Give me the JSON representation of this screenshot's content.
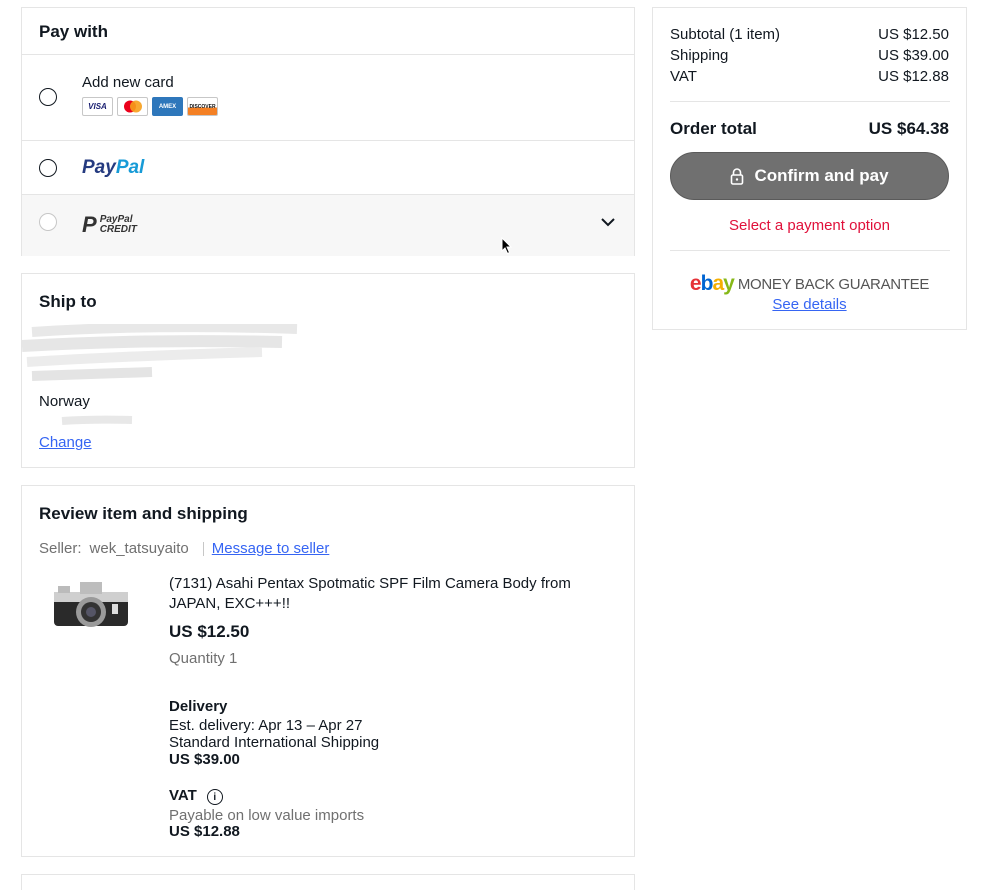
{
  "payment": {
    "title": "Pay with",
    "add_card_label": "Add new card",
    "card_logos": [
      "VISA",
      "MC",
      "AMEX",
      "DISCOVER"
    ],
    "paypal_part1": "Pay",
    "paypal_part2": "Pal",
    "credit_line1": "PayPal",
    "credit_line2": "CREDIT"
  },
  "ship_to": {
    "title": "Ship to",
    "country": "Norway",
    "change_link": "Change"
  },
  "review": {
    "title": "Review item and shipping",
    "seller_label": "Seller:",
    "seller_name": "wek_tatsuyaito",
    "message_link": "Message to seller",
    "item_title": "(7131) Asahi Pentax Spotmatic SPF Film Camera Body from JAPAN, EXC+++!!",
    "item_price": "US $12.50",
    "quantity": "Quantity 1",
    "delivery_heading": "Delivery",
    "delivery_estimate": "Est. delivery: Apr 13 – Apr 27",
    "delivery_method": "Standard International Shipping",
    "delivery_price": "US $39.00",
    "vat_heading": "VAT",
    "vat_note": "Payable on low value imports",
    "vat_price": "US $12.88"
  },
  "summary": {
    "subtotal_label": "Subtotal (1 item)",
    "subtotal_value": "US $12.50",
    "shipping_label": "Shipping",
    "shipping_value": "US $39.00",
    "vat_label": "VAT",
    "vat_value": "US $12.88",
    "total_label": "Order total",
    "total_value": "US $64.38",
    "confirm_button": "Confirm and pay",
    "select_message": "Select a payment option",
    "guarantee_text": "MONEY BACK GUARANTEE",
    "see_details": "See details"
  },
  "colors": {
    "link": "#3665f3",
    "error": "#e0103a",
    "button_disabled": "#707070"
  },
  "icons": [
    "chevron-down-icon",
    "lock-icon",
    "info-icon",
    "cursor-icon"
  ]
}
